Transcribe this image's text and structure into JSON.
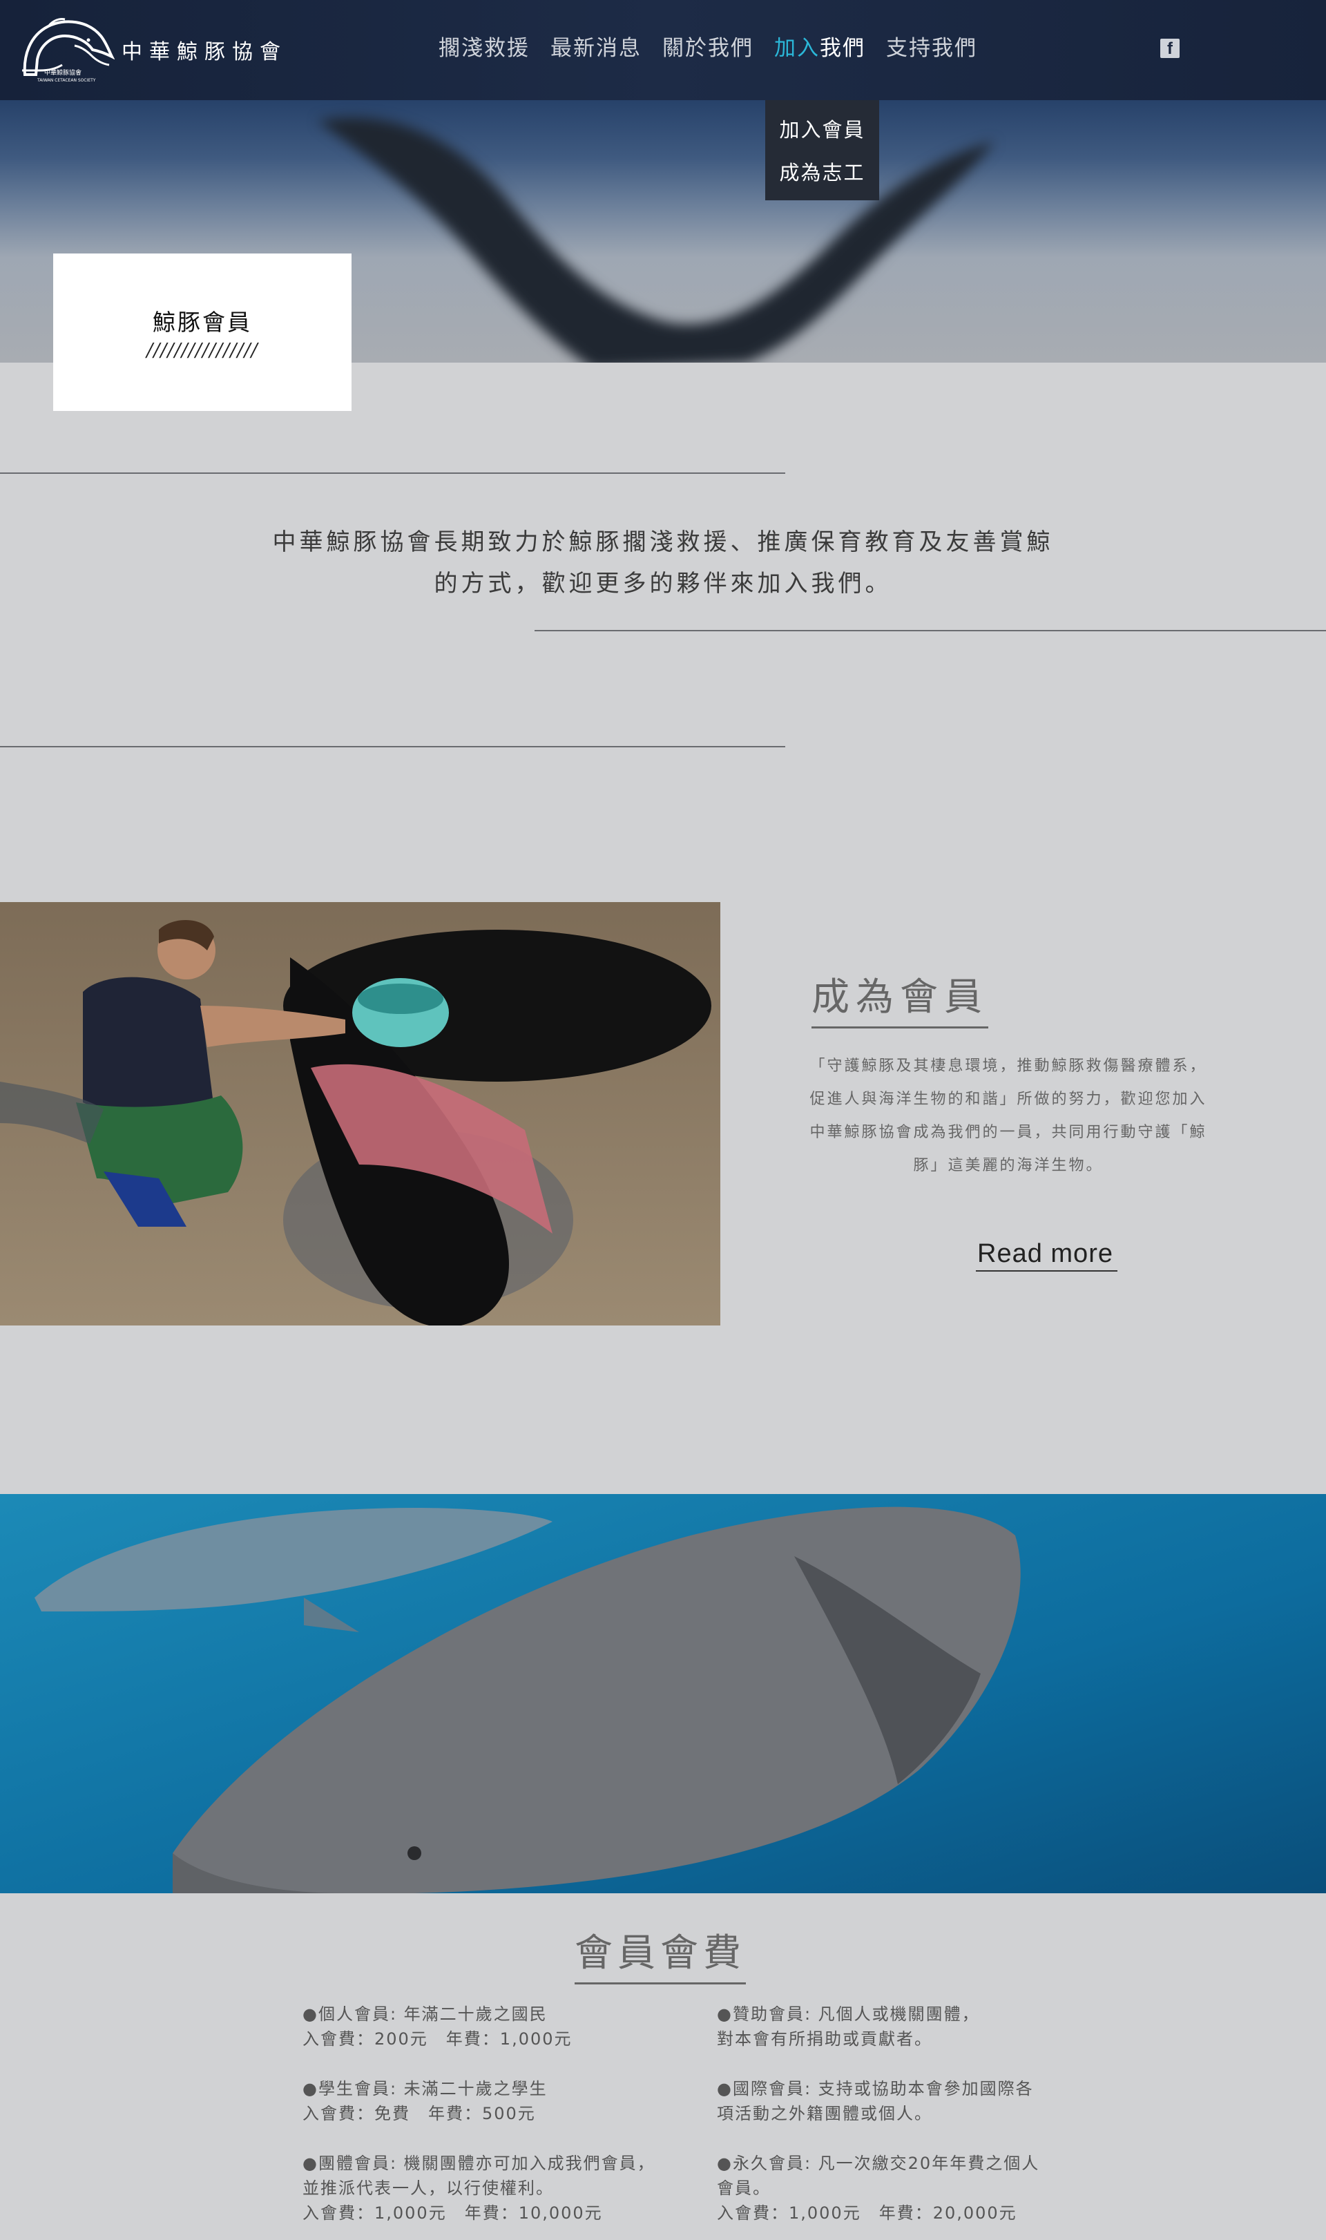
{
  "brand": {
    "name": "中華鯨豚協會",
    "logo_caption": "中華鯨豚協會",
    "logo_caption_en": "TAIWAN CETACEAN SOCIETY"
  },
  "nav": {
    "items": [
      {
        "label": "擱淺救援"
      },
      {
        "label": "最新消息"
      },
      {
        "label": "關於我們"
      },
      {
        "label_part1": "加入",
        "label_part2": "我們"
      },
      {
        "label": "支持我們"
      }
    ],
    "social_icon": "facebook-icon",
    "social_glyph": "f"
  },
  "dropdown": {
    "items": [
      "加入會員",
      "成為志工"
    ]
  },
  "hero": {
    "title": "鯨豚會員",
    "decoration": "////////////////"
  },
  "intro": {
    "text": "中華鯨豚協會長期致力於鯨豚擱淺救援、推廣保育教育及友善賞鯨的方式，歡迎更多的夥伴來加入我們。"
  },
  "member": {
    "heading": "成為會員",
    "description": "「守護鯨豚及其棲息環境，推動鯨豚救傷醫療體系，促進人與海洋生物的和諧」所做的努力，歡迎您加入中華鯨豚協會成為我們的一員，共同用行動守護「鯨豚」這美麗的海洋生物。",
    "read_more": "Read more"
  },
  "fees": {
    "heading": "會員會費",
    "left": [
      {
        "line1": "●個人會員: 年滿二十歲之國民",
        "line2": "入會費：200元　年費：1,000元"
      },
      {
        "line1": "●學生會員: 未滿二十歲之學生",
        "line2": "入會費：免費　年費：500元"
      },
      {
        "line1": "●團體會員: 機關團體亦可加入成我們會員，",
        "line2": "並推派代表一人，以行使權利。",
        "line3": "入會費：1,000元　年費：10,000元"
      }
    ],
    "right": [
      {
        "line1": "●贊助會員: 凡個人或機關團體，",
        "line2": "對本會有所捐助或貢獻者。"
      },
      {
        "line1": "●國際會員:  支持或協助本會參加國際各",
        "line2": "項活動之外籍團體或個人。"
      },
      {
        "line1": "●永久會員:  凡一次繳交20年年費之個人",
        "line2": "會員。",
        "line3": "入會費：1,000元　年費：20,000元"
      }
    ]
  },
  "colors": {
    "nav_bg": "#1b273f",
    "accent": "#2bb7d8",
    "page_bg": "#d1d2d4"
  }
}
